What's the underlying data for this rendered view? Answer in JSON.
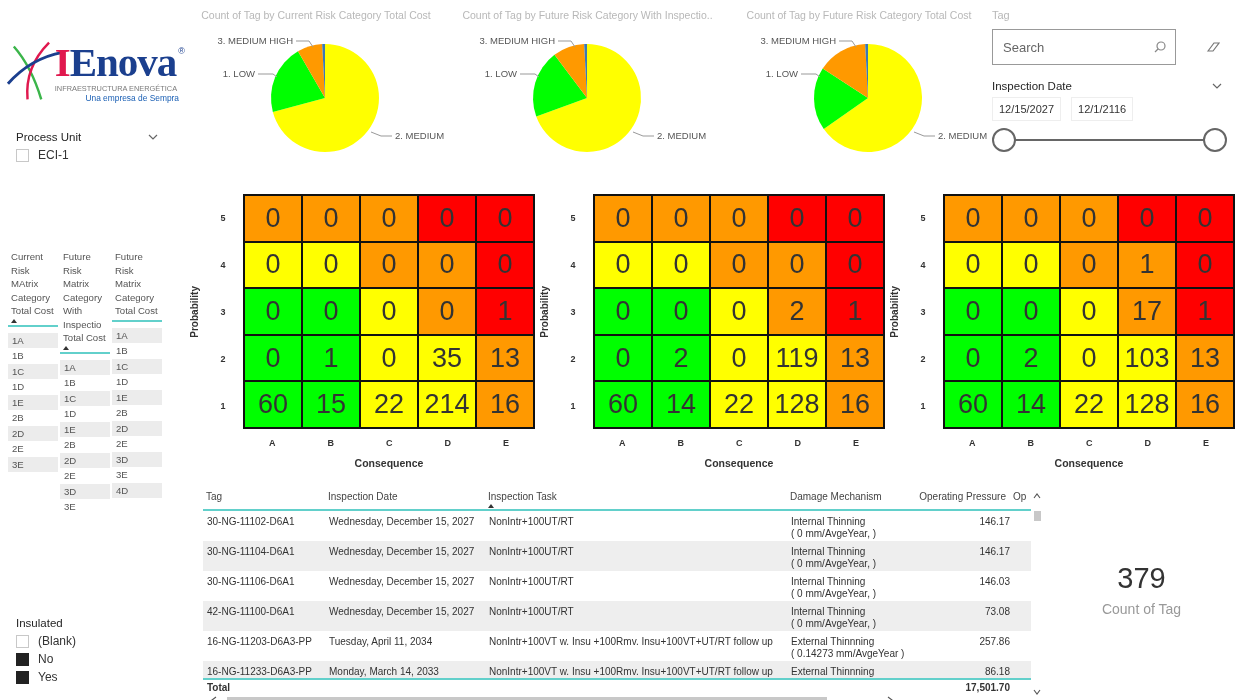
{
  "logo": {
    "name": "IEnova",
    "mark": "®",
    "tagline": "INFRAESTRUCTURA ENERGÉTICA",
    "subtitle": "Una empresa de Sempra"
  },
  "process_unit": {
    "title": "Process Unit",
    "items": [
      {
        "label": "ECI-1",
        "checked": false
      }
    ]
  },
  "category_lists": [
    {
      "header": "Current Risk MAtrix Category Total Cost",
      "sorted": true,
      "items": [
        "1A",
        "1B",
        "1C",
        "1D",
        "1E",
        "2B",
        "2D",
        "2E",
        "3E"
      ]
    },
    {
      "header": "Future Risk Matrix Category With Inspectio Total Cost",
      "sorted": true,
      "items": [
        "1A",
        "1B",
        "1C",
        "1D",
        "1E",
        "2B",
        "2D",
        "2E",
        "3D",
        "3E"
      ]
    },
    {
      "header": "Future Risk Matrix Category Total Cost",
      "sorted": false,
      "items": [
        "1A",
        "1B",
        "1C",
        "1D",
        "1E",
        "2B",
        "2D",
        "2E",
        "3D",
        "3E",
        "4D"
      ]
    }
  ],
  "insulated": {
    "title": "Insulated",
    "items": [
      {
        "label": "(Blank)",
        "checked": false
      },
      {
        "label": "No",
        "checked": true
      },
      {
        "label": "Yes",
        "checked": true
      }
    ]
  },
  "pies": [
    {
      "title": "Count of Tag by Current Risk Category Total Cost",
      "slices": [
        {
          "label": "3. MEDIUM HIGH",
          "color": "#ff9900"
        },
        {
          "label": "1. LOW",
          "color": "#00ff00"
        },
        {
          "label": "2. MEDIUM",
          "color": "#ffff00"
        }
      ]
    },
    {
      "title": "Count of Tag by Future Risk Category With Inspectio..",
      "slices": [
        {
          "label": "3. MEDIUM HIGH",
          "color": "#ff9900"
        },
        {
          "label": "1. LOW",
          "color": "#00ff00"
        },
        {
          "label": "2. MEDIUM",
          "color": "#ffff00"
        }
      ]
    },
    {
      "title": "Count of Tag by Future Risk Category Total Cost",
      "slices": [
        {
          "label": "3. MEDIUM HIGH",
          "color": "#ff9900"
        },
        {
          "label": "1. LOW",
          "color": "#00ff00"
        },
        {
          "label": "2. MEDIUM",
          "color": "#ffff00"
        }
      ]
    }
  ],
  "tag_slicer": {
    "title": "Tag",
    "placeholder": "Search"
  },
  "date_slicer": {
    "title": "Inspection Date",
    "start": "12/15/2027",
    "end": "12/1/2116",
    "thumbs": [
      {
        "level": 0
      },
      {
        "level": 1
      }
    ]
  },
  "matrices": [
    {
      "ylabel": "Probability",
      "xlabel": "Consequence",
      "row_labels": [
        "5",
        "4",
        "3",
        "2",
        "1"
      ],
      "col_labels": [
        "A",
        "B",
        "C",
        "D",
        "E"
      ],
      "rows": [
        [
          {
            "value": "0",
            "color": "#ff9900"
          },
          {
            "value": "0",
            "color": "#ff9900"
          },
          {
            "value": "0",
            "color": "#ff9900"
          },
          {
            "value": "0",
            "color": "#ff0000"
          },
          {
            "value": "0",
            "color": "#ff0000"
          }
        ],
        [
          {
            "value": "0",
            "color": "#ffff00"
          },
          {
            "value": "0",
            "color": "#ffff00"
          },
          {
            "value": "0",
            "color": "#ff9900"
          },
          {
            "value": "0",
            "color": "#ff9900"
          },
          {
            "value": "0",
            "color": "#ff0000"
          }
        ],
        [
          {
            "value": "0",
            "color": "#00ff00"
          },
          {
            "value": "0",
            "color": "#00ff00"
          },
          {
            "value": "0",
            "color": "#ffff00"
          },
          {
            "value": "0",
            "color": "#ff9900"
          },
          {
            "value": "1",
            "color": "#ff0000"
          }
        ],
        [
          {
            "value": "0",
            "color": "#00ff00"
          },
          {
            "value": "1",
            "color": "#00ff00"
          },
          {
            "value": "0",
            "color": "#ffff00"
          },
          {
            "value": "35",
            "color": "#ffff00"
          },
          {
            "value": "13",
            "color": "#ff9900"
          }
        ],
        [
          {
            "value": "60",
            "color": "#00ff00"
          },
          {
            "value": "15",
            "color": "#00ff00"
          },
          {
            "value": "22",
            "color": "#ffff00"
          },
          {
            "value": "214",
            "color": "#ffff00"
          },
          {
            "value": "16",
            "color": "#ff9900"
          }
        ]
      ]
    },
    {
      "ylabel": "Probability",
      "xlabel": "Consequence",
      "row_labels": [
        "5",
        "4",
        "3",
        "2",
        "1"
      ],
      "col_labels": [
        "A",
        "B",
        "C",
        "D",
        "E"
      ],
      "rows": [
        [
          {
            "value": "0",
            "color": "#ff9900"
          },
          {
            "value": "0",
            "color": "#ff9900"
          },
          {
            "value": "0",
            "color": "#ff9900"
          },
          {
            "value": "0",
            "color": "#ff0000"
          },
          {
            "value": "0",
            "color": "#ff0000"
          }
        ],
        [
          {
            "value": "0",
            "color": "#ffff00"
          },
          {
            "value": "0",
            "color": "#ffff00"
          },
          {
            "value": "0",
            "color": "#ff9900"
          },
          {
            "value": "0",
            "color": "#ff9900"
          },
          {
            "value": "0",
            "color": "#ff0000"
          }
        ],
        [
          {
            "value": "0",
            "color": "#00ff00"
          },
          {
            "value": "0",
            "color": "#00ff00"
          },
          {
            "value": "0",
            "color": "#ffff00"
          },
          {
            "value": "2",
            "color": "#ff9900"
          },
          {
            "value": "1",
            "color": "#ff0000"
          }
        ],
        [
          {
            "value": "0",
            "color": "#00ff00"
          },
          {
            "value": "2",
            "color": "#00ff00"
          },
          {
            "value": "0",
            "color": "#ffff00"
          },
          {
            "value": "119",
            "color": "#ffff00"
          },
          {
            "value": "13",
            "color": "#ff9900"
          }
        ],
        [
          {
            "value": "60",
            "color": "#00ff00"
          },
          {
            "value": "14",
            "color": "#00ff00"
          },
          {
            "value": "22",
            "color": "#ffff00"
          },
          {
            "value": "128",
            "color": "#ffff00"
          },
          {
            "value": "16",
            "color": "#ff9900"
          }
        ]
      ]
    },
    {
      "ylabel": "Probability",
      "xlabel": "Consequence",
      "row_labels": [
        "5",
        "4",
        "3",
        "2",
        "1"
      ],
      "col_labels": [
        "A",
        "B",
        "C",
        "D",
        "E"
      ],
      "rows": [
        [
          {
            "value": "0",
            "color": "#ff9900"
          },
          {
            "value": "0",
            "color": "#ff9900"
          },
          {
            "value": "0",
            "color": "#ff9900"
          },
          {
            "value": "0",
            "color": "#ff0000"
          },
          {
            "value": "0",
            "color": "#ff0000"
          }
        ],
        [
          {
            "value": "0",
            "color": "#ffff00"
          },
          {
            "value": "0",
            "color": "#ffff00"
          },
          {
            "value": "0",
            "color": "#ff9900"
          },
          {
            "value": "1",
            "color": "#ff9900"
          },
          {
            "value": "0",
            "color": "#ff0000"
          }
        ],
        [
          {
            "value": "0",
            "color": "#00ff00"
          },
          {
            "value": "0",
            "color": "#00ff00"
          },
          {
            "value": "0",
            "color": "#ffff00"
          },
          {
            "value": "17",
            "color": "#ff9900"
          },
          {
            "value": "1",
            "color": "#ff0000"
          }
        ],
        [
          {
            "value": "0",
            "color": "#00ff00"
          },
          {
            "value": "2",
            "color": "#00ff00"
          },
          {
            "value": "0",
            "color": "#ffff00"
          },
          {
            "value": "103",
            "color": "#ffff00"
          },
          {
            "value": "13",
            "color": "#ff9900"
          }
        ],
        [
          {
            "value": "60",
            "color": "#00ff00"
          },
          {
            "value": "14",
            "color": "#00ff00"
          },
          {
            "value": "22",
            "color": "#ffff00"
          },
          {
            "value": "128",
            "color": "#ffff00"
          },
          {
            "value": "16",
            "color": "#ff9900"
          }
        ]
      ]
    }
  ],
  "table": {
    "columns": [
      {
        "label": "Tag",
        "sorted": false
      },
      {
        "label": "Inspection Date",
        "sorted": false
      },
      {
        "label": "Inspection Task",
        "sorted": true
      },
      {
        "label": "Damage Mechanism",
        "sorted": false
      },
      {
        "label": "Operating Pressure",
        "sorted": false
      },
      {
        "label": "Op",
        "sorted": false
      }
    ],
    "rows": [
      {
        "tag": "30-NG-11102-D6A1",
        "date": "Wednesday, December 15, 2027",
        "task": "NonIntr+100UT/RT",
        "mechanism": "Internal Thinning",
        "rate": "( 0 mm/AvgeYear, )",
        "pressure": "146.17"
      },
      {
        "tag": "30-NG-11104-D6A1",
        "date": "Wednesday, December 15, 2027",
        "task": "NonIntr+100UT/RT",
        "mechanism": "Internal Thinning",
        "rate": "( 0 mm/AvgeYear, )",
        "pressure": "146.17"
      },
      {
        "tag": "30-NG-11106-D6A1",
        "date": "Wednesday, December 15, 2027",
        "task": "NonIntr+100UT/RT",
        "mechanism": "Internal Thinning",
        "rate": "( 0 mm/AvgeYear, )",
        "pressure": "146.03"
      },
      {
        "tag": "42-NG-11100-D6A1",
        "date": "Wednesday, December 15, 2027",
        "task": "NonIntr+100UT/RT",
        "mechanism": "Internal Thinning",
        "rate": "( 0 mm/AvgeYear, )",
        "pressure": "73.08"
      },
      {
        "tag": "16-NG-11203-D6A3-PP",
        "date": "Tuesday, April 11, 2034",
        "task": "NonIntr+100VT w. Insu +100Rmv. Insu+100VT+UT/RT follow up",
        "mechanism": "External Thinnning",
        "rate": "( 0.14273 mm/AvgeYear )",
        "pressure": "257.86"
      },
      {
        "tag": "16-NG-11233-D6A3-PP",
        "date": "Monday, March 14, 2033",
        "task": "NonIntr+100VT w. Insu +100Rmv. Insu+100VT+UT/RT follow up",
        "mechanism": "External Thinnning",
        "pressure": "86.18"
      }
    ],
    "total": {
      "label": "Total",
      "value": "17,501.70"
    }
  },
  "card": {
    "value": "379",
    "label": "Count of Tag"
  }
}
